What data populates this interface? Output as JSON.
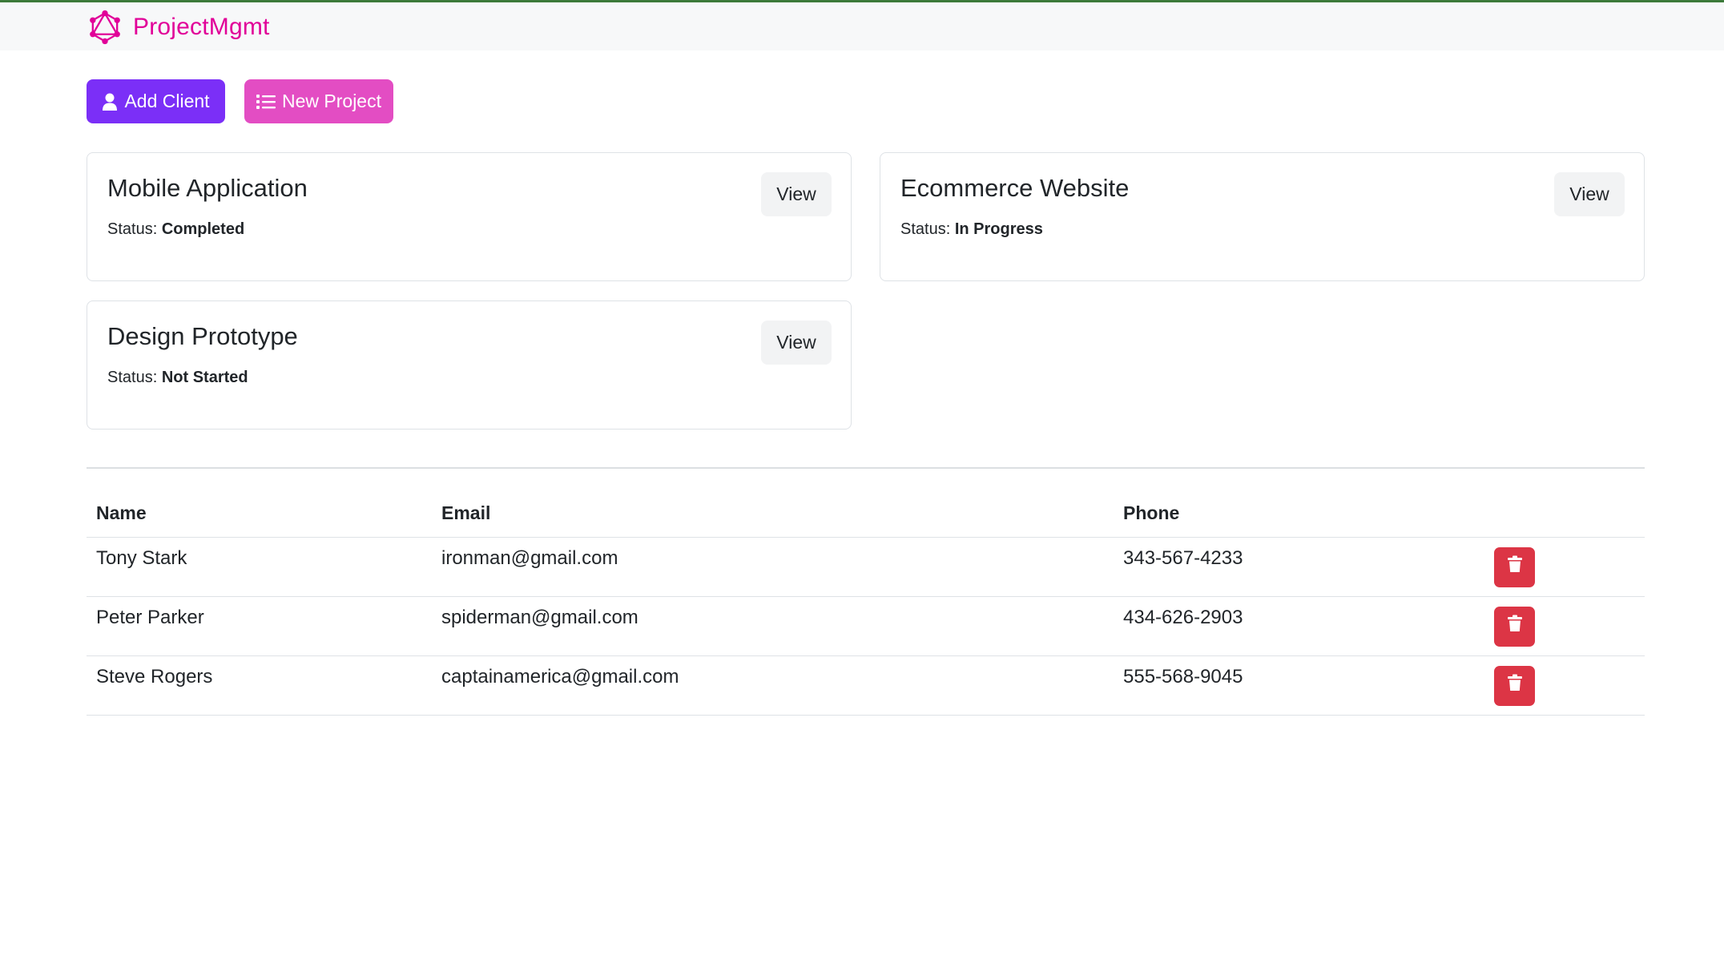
{
  "brand": {
    "name": "ProjectMgmt",
    "icon": "graphql-logo-icon",
    "color": "#e10098"
  },
  "actions": {
    "add_client_label": "Add Client",
    "add_client_icon": "user-icon",
    "new_project_label": "New Project",
    "new_project_icon": "list-icon"
  },
  "projects": [
    {
      "title": "Mobile Application",
      "status_label": "Status:",
      "status": "Completed",
      "view_label": "View"
    },
    {
      "title": "Ecommerce Website",
      "status_label": "Status:",
      "status": "In Progress",
      "view_label": "View"
    },
    {
      "title": "Design Prototype",
      "status_label": "Status:",
      "status": "Not Started",
      "view_label": "View"
    }
  ],
  "clients": {
    "headers": {
      "name": "Name",
      "email": "Email",
      "phone": "Phone"
    },
    "rows": [
      {
        "name": "Tony Stark",
        "email": "ironman@gmail.com",
        "phone": "343-567-4233",
        "delete_icon": "trash-icon"
      },
      {
        "name": "Peter Parker",
        "email": "spiderman@gmail.com",
        "phone": "434-626-2903",
        "delete_icon": "trash-icon"
      },
      {
        "name": "Steve Rogers",
        "email": "captainamerica@gmail.com",
        "phone": "555-568-9045",
        "delete_icon": "trash-icon"
      }
    ]
  },
  "colors": {
    "add_client": "#7b2ff7",
    "new_project": "#e34dc3",
    "delete": "#dc3545"
  }
}
